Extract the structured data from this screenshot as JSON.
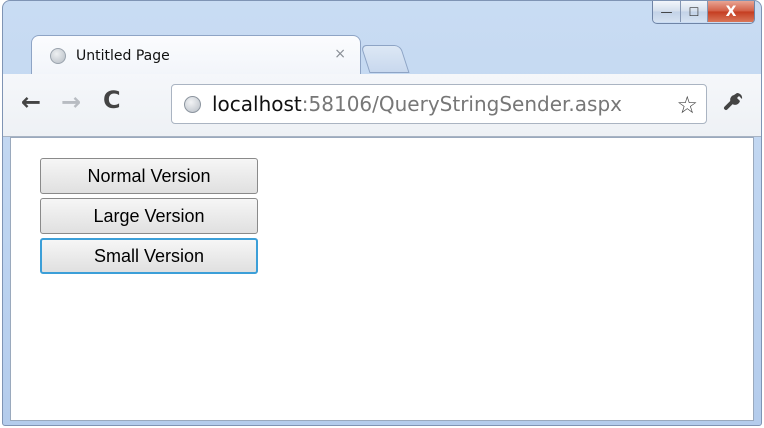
{
  "window": {
    "controls": {
      "minimize": "—",
      "maximize": "☐",
      "close": "X"
    }
  },
  "tab": {
    "title": "Untitled Page",
    "close": "×"
  },
  "toolbar": {
    "back": "←",
    "forward": "→",
    "reload": "C",
    "url_host": "localhost",
    "url_path": ":58106/QueryStringSender.aspx",
    "star": "☆",
    "wrench": "🔧"
  },
  "page": {
    "buttons": [
      "Normal Version",
      "Large Version",
      "Small Version"
    ]
  }
}
